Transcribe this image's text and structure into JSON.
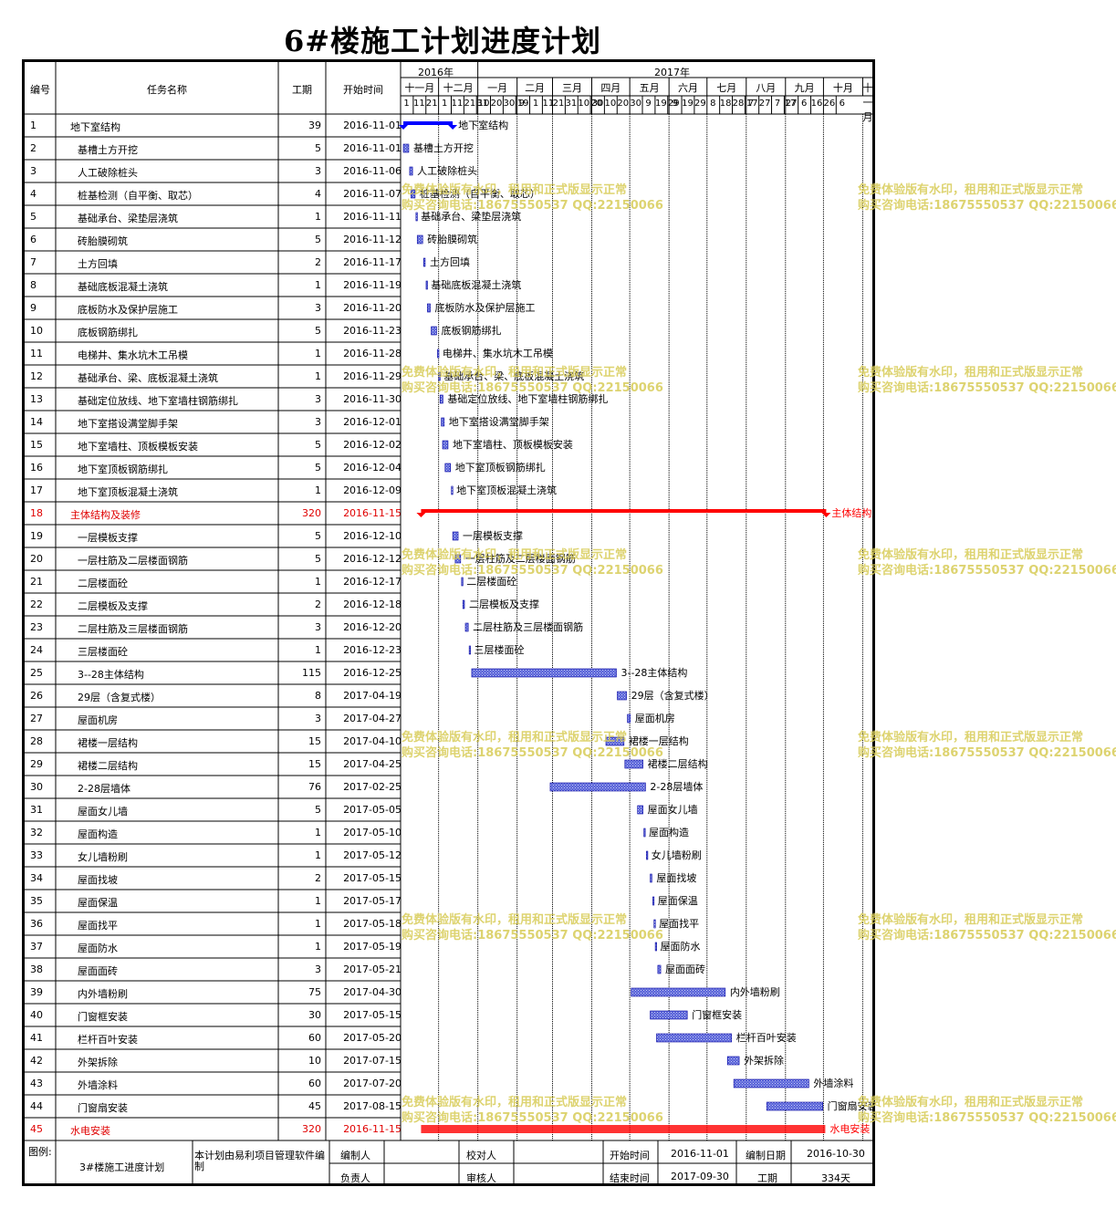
{
  "title": "6#楼施工计划进度计划",
  "headers": {
    "no": "编号",
    "name": "任务名称",
    "duration": "工期",
    "start": "开始时间"
  },
  "years": [
    {
      "label": "2016年"
    },
    {
      "label": "2017年"
    }
  ],
  "months": [
    "十一月",
    "十二月",
    "一月",
    "二月",
    "三月",
    "四月",
    "五月",
    "六月",
    "七月",
    "八月",
    "九月",
    "十月",
    "十一月"
  ],
  "day_ticks": [
    "1",
    "11",
    "21",
    "1",
    "11",
    "21",
    "31",
    "10",
    "20",
    "30",
    "9",
    "19",
    "1",
    "11",
    "21",
    "31",
    "10",
    "20",
    "30",
    "10",
    "20",
    "30",
    "9",
    "19",
    "29",
    "9",
    "19",
    "29",
    "8",
    "18",
    "28",
    "7",
    "17",
    "27",
    "7",
    "17",
    "27",
    "6",
    "16",
    "26",
    "6"
  ],
  "watermark": {
    "line1": "免费体验版有水印，租用和正式版显示正常",
    "line2": "购买咨询电话:18675550537 QQ:22150066"
  },
  "footer": {
    "legend_label": "图例:",
    "plan_name": "3#楼施工进度计划",
    "note": "本计划由易利项目管理软件编制",
    "editor_label": "编制人",
    "checker_label": "校对人",
    "start_label": "开始时间",
    "start_value": "2016-11-01",
    "date_label": "编制日期",
    "date_value": "2016-10-30",
    "owner_label": "负责人",
    "reviewer_label": "审核人",
    "end_label": "结束时间",
    "end_value": "2017-09-30",
    "total_label": "工期",
    "total_value": "334天"
  },
  "colors": {
    "summary": "#0000ff",
    "critical": "#ff0000",
    "task_fill": "#5560d8",
    "task_border": "#0000a0",
    "watermark": "#d8cc58"
  },
  "chart_data": {
    "type": "gantt",
    "x_axis": {
      "start": "2016-11-01",
      "end": "2017-11-06"
    },
    "tasks": [
      {
        "no": "1",
        "name": "地下室结构",
        "duration": 39,
        "start": "2016-11-01",
        "kind": "summary",
        "indent": 0
      },
      {
        "no": "2",
        "name": "基槽土方开挖",
        "duration": 5,
        "start": "2016-11-01",
        "kind": "task",
        "indent": 1
      },
      {
        "no": "3",
        "name": "人工破除桩头",
        "duration": 3,
        "start": "2016-11-06",
        "kind": "task",
        "indent": 1
      },
      {
        "no": "4",
        "name": "桩基检测（自平衡、取芯）",
        "duration": 4,
        "start": "2016-11-07",
        "kind": "task",
        "indent": 1
      },
      {
        "no": "5",
        "name": "基础承台、梁垫层浇筑",
        "duration": 1,
        "start": "2016-11-11",
        "kind": "task",
        "indent": 1
      },
      {
        "no": "6",
        "name": "砖胎膜砌筑",
        "duration": 5,
        "start": "2016-11-12",
        "kind": "task",
        "indent": 1
      },
      {
        "no": "7",
        "name": "土方回填",
        "duration": 2,
        "start": "2016-11-17",
        "kind": "task",
        "indent": 1
      },
      {
        "no": "8",
        "name": "基础底板混凝土浇筑",
        "duration": 1,
        "start": "2016-11-19",
        "kind": "task",
        "indent": 1
      },
      {
        "no": "9",
        "name": "底板防水及保护层施工",
        "duration": 3,
        "start": "2016-11-20",
        "kind": "task",
        "indent": 1
      },
      {
        "no": "10",
        "name": "底板钢筋绑扎",
        "duration": 5,
        "start": "2016-11-23",
        "kind": "task",
        "indent": 1
      },
      {
        "no": "11",
        "name": "电梯井、集水坑木工吊模",
        "duration": 1,
        "start": "2016-11-28",
        "kind": "task",
        "indent": 1
      },
      {
        "no": "12",
        "name": "基础承台、梁、底板混凝土浇筑",
        "duration": 1,
        "start": "2016-11-29",
        "kind": "task",
        "indent": 1
      },
      {
        "no": "13",
        "name": "基础定位放线、地下室墙柱钢筋绑扎",
        "duration": 3,
        "start": "2016-11-30",
        "kind": "task",
        "indent": 1
      },
      {
        "no": "14",
        "name": "地下室搭设满堂脚手架",
        "duration": 3,
        "start": "2016-12-01",
        "kind": "task",
        "indent": 1
      },
      {
        "no": "15",
        "name": "地下室墙柱、顶板模板安装",
        "duration": 5,
        "start": "2016-12-02",
        "kind": "task",
        "indent": 1
      },
      {
        "no": "16",
        "name": "地下室顶板钢筋绑扎",
        "duration": 5,
        "start": "2016-12-04",
        "kind": "task",
        "indent": 1
      },
      {
        "no": "17",
        "name": "地下室顶板混凝土浇筑",
        "duration": 1,
        "start": "2016-12-09",
        "kind": "task",
        "indent": 1
      },
      {
        "no": "18",
        "name": "主体结构及装修",
        "duration": 320,
        "start": "2016-11-15",
        "kind": "critical",
        "indent": 0
      },
      {
        "no": "19",
        "name": "一层模板支撑",
        "duration": 5,
        "start": "2016-12-10",
        "kind": "task",
        "indent": 1
      },
      {
        "no": "20",
        "name": "一层柱筋及二层楼面钢筋",
        "duration": 5,
        "start": "2016-12-12",
        "kind": "task",
        "indent": 1
      },
      {
        "no": "21",
        "name": "二层楼面砼",
        "duration": 1,
        "start": "2016-12-17",
        "kind": "task",
        "indent": 1
      },
      {
        "no": "22",
        "name": "二层模板及支撑",
        "duration": 2,
        "start": "2016-12-18",
        "kind": "task",
        "indent": 1
      },
      {
        "no": "23",
        "name": "二层柱筋及三层楼面钢筋",
        "duration": 3,
        "start": "2016-12-20",
        "kind": "task",
        "indent": 1
      },
      {
        "no": "24",
        "name": "三层楼面砼",
        "duration": 1,
        "start": "2016-12-23",
        "kind": "task",
        "indent": 1
      },
      {
        "no": "25",
        "name": "3--28主体结构",
        "duration": 115,
        "start": "2016-12-25",
        "kind": "task",
        "indent": 1
      },
      {
        "no": "26",
        "name": "29层（含复式楼）",
        "duration": 8,
        "start": "2017-04-19",
        "kind": "task",
        "indent": 1
      },
      {
        "no": "27",
        "name": "屋面机房",
        "duration": 3,
        "start": "2017-04-27",
        "kind": "task",
        "indent": 1
      },
      {
        "no": "28",
        "name": "裙楼一层结构",
        "duration": 15,
        "start": "2017-04-10",
        "kind": "task",
        "indent": 1
      },
      {
        "no": "29",
        "name": "裙楼二层结构",
        "duration": 15,
        "start": "2017-04-25",
        "kind": "task",
        "indent": 1
      },
      {
        "no": "30",
        "name": "2-28层墙体",
        "duration": 76,
        "start": "2017-02-25",
        "kind": "task",
        "indent": 1
      },
      {
        "no": "31",
        "name": "屋面女儿墙",
        "duration": 5,
        "start": "2017-05-05",
        "kind": "task",
        "indent": 1
      },
      {
        "no": "32",
        "name": "屋面构造",
        "duration": 1,
        "start": "2017-05-10",
        "kind": "task",
        "indent": 1
      },
      {
        "no": "33",
        "name": "女儿墙粉刷",
        "duration": 1,
        "start": "2017-05-12",
        "kind": "task",
        "indent": 1
      },
      {
        "no": "34",
        "name": "屋面找坡",
        "duration": 2,
        "start": "2017-05-15",
        "kind": "task",
        "indent": 1
      },
      {
        "no": "35",
        "name": "屋面保温",
        "duration": 1,
        "start": "2017-05-17",
        "kind": "task",
        "indent": 1
      },
      {
        "no": "36",
        "name": "屋面找平",
        "duration": 1,
        "start": "2017-05-18",
        "kind": "task",
        "indent": 1
      },
      {
        "no": "37",
        "name": "屋面防水",
        "duration": 1,
        "start": "2017-05-19",
        "kind": "task",
        "indent": 1
      },
      {
        "no": "38",
        "name": "屋面面砖",
        "duration": 3,
        "start": "2017-05-21",
        "kind": "task",
        "indent": 1
      },
      {
        "no": "39",
        "name": "内外墙粉刷",
        "duration": 75,
        "start": "2017-04-30",
        "kind": "task",
        "indent": 1
      },
      {
        "no": "40",
        "name": "门窗框安装",
        "duration": 30,
        "start": "2017-05-15",
        "kind": "task",
        "indent": 1
      },
      {
        "no": "41",
        "name": "栏杆百叶安装",
        "duration": 60,
        "start": "2017-05-20",
        "kind": "task",
        "indent": 1
      },
      {
        "no": "42",
        "name": "外架拆除",
        "duration": 10,
        "start": "2017-07-15",
        "kind": "task",
        "indent": 1
      },
      {
        "no": "43",
        "name": "外墙涂料",
        "duration": 60,
        "start": "2017-07-20",
        "kind": "task",
        "indent": 1
      },
      {
        "no": "44",
        "name": "门窗扇安装",
        "duration": 45,
        "start": "2017-08-15",
        "kind": "task",
        "indent": 1
      },
      {
        "no": "45",
        "name": "水电安装",
        "duration": 320,
        "start": "2016-11-15",
        "kind": "critical_bar",
        "indent": 0
      }
    ]
  }
}
